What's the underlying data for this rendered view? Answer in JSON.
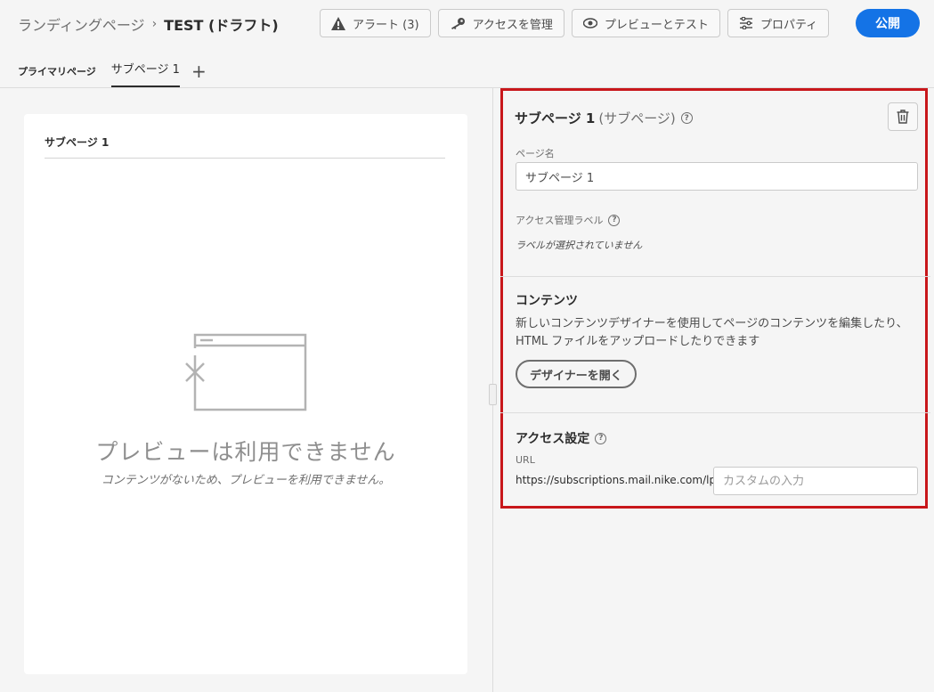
{
  "breadcrumb": {
    "parent": "ランディングページ",
    "separator": "›",
    "current": "TEST (ドラフト)"
  },
  "toolbar": {
    "alert_label": "アラート (3)",
    "access_label": "アクセスを管理",
    "preview_label": "プレビューとテスト",
    "properties_label": "プロパティ",
    "publish_label": "公開"
  },
  "tabs": {
    "primary": "プライマリページ",
    "sub": "サブページ 1",
    "add": "+"
  },
  "preview": {
    "title": "サブページ 1",
    "empty_title": "プレビューは利用できません",
    "empty_sub": "コンテンツがないため、プレビューを利用できません。"
  },
  "panel": {
    "title": "サブページ 1",
    "title_type": "(サブページ)",
    "page_name_label": "ページ名",
    "page_name_value": "サブページ 1",
    "access_label_title": "アクセス管理ラベル",
    "access_label_note": "ラベルが選択されていません",
    "content_title": "コンテンツ",
    "content_desc": "新しいコンテンツデザイナーを使用してページのコンテンツを編集したり、HTML ファイルをアップロードしたりできます",
    "open_designer": "デザイナーを開く",
    "access_settings_title": "アクセス設定",
    "url_label": "URL",
    "url_prefix": "https://subscriptions.mail.nike.com/lp/",
    "url_placeholder": "カスタムの入力"
  },
  "colors": {
    "accent": "#1473e6",
    "highlight_border": "#c8171b"
  },
  "icons": [
    "alert-icon",
    "key-icon",
    "eye-icon",
    "settings-sliders-icon",
    "trash-icon",
    "help-icon",
    "empty-window-icon"
  ]
}
